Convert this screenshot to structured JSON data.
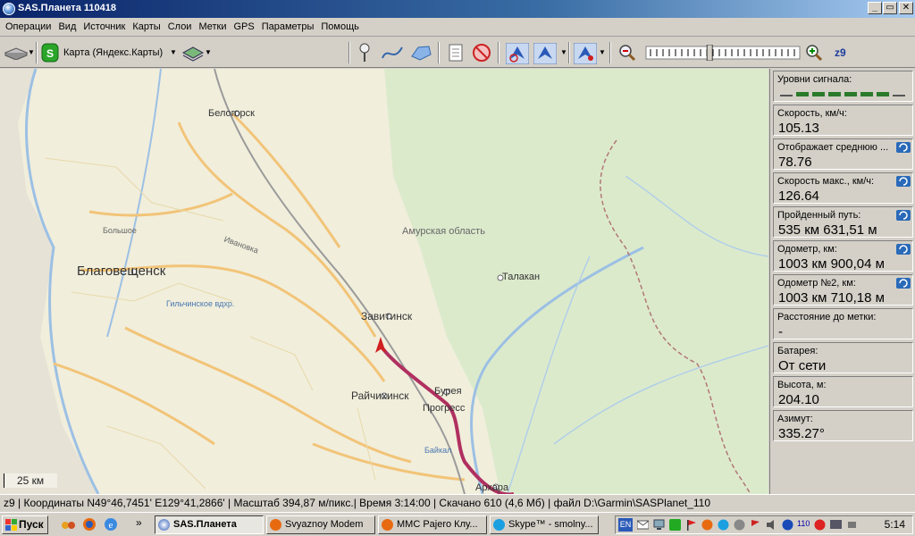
{
  "window": {
    "title": "SAS.Планета 110418",
    "minimize": "_",
    "maximize": "▭",
    "close": "✕"
  },
  "menu": [
    "Операции",
    "Вид",
    "Источник",
    "Карты",
    "Слои",
    "Метки",
    "GPS",
    "Параметры",
    "Помощь"
  ],
  "toolbar": {
    "map_source": "Карта (Яндекс.Карты)",
    "zoom_level": "z9",
    "zoom_slider_fraction": 0.41
  },
  "map": {
    "labels": {
      "blagoveshchensk": "Благовещенск",
      "belogorsk": "Белогорск",
      "zavitinsk": "Завитинск",
      "raichikhinsk": "Райчихинск",
      "progress": "Прогресс",
      "bureya": "Бурея",
      "talakan": "Талакан",
      "arkhara": "Архара",
      "amur_oblast": "Амурская область",
      "bolshoe": "Большое",
      "ivanovka": "Ивановка",
      "gilchin": "Гильчинское вдхр.",
      "baikal": "Байкал"
    },
    "scale": "25 км"
  },
  "sidebar": {
    "signal_label": "Уровни сигнала:",
    "signal_bars": 8,
    "panels": [
      {
        "label": "Скорость, км/ч:",
        "value": "105.13",
        "reset": false
      },
      {
        "label": "Отображает среднюю ...",
        "value": "78.76",
        "reset": true
      },
      {
        "label": "Скорость макс., км/ч:",
        "value": "126.64",
        "reset": true
      },
      {
        "label": "Пройденный путь:",
        "value": "535 км 631,51 м",
        "reset": true
      },
      {
        "label": "Одометр, км:",
        "value": "1003 км 900,04 м",
        "reset": true
      },
      {
        "label": "Одометр №2, км:",
        "value": "1003 км 710,18 м",
        "reset": true
      },
      {
        "label": "Расстояние до метки:",
        "value": "-",
        "reset": false
      },
      {
        "label": "Батарея:",
        "value": "От сети",
        "reset": false
      },
      {
        "label": "Высота, м:",
        "value": "204.10",
        "reset": false
      },
      {
        "label": "Азимут:",
        "value": "335.27°",
        "reset": false
      }
    ]
  },
  "status": "z9   | Координаты N49°46,7451' E129°41,2866' | Масштаб 394,87 м/пикс.| Время 3:14:00 | Скачано 610 (4,6 Мб) | файл D:\\Garmin\\SASPlanet_110",
  "taskbar": {
    "start": "Пуск",
    "more": "»",
    "tasks": [
      "SAS.Планета",
      "Svyaznoy Modem",
      "MMC Pajero Клу...",
      "Skype™ - smolny..."
    ],
    "tray_lang": "EN",
    "tray_num": "110",
    "clock": "5:14"
  },
  "colors": {
    "route": "#b03060",
    "road": "#f5c87a",
    "forest": "#d6e8c4",
    "water": "#a8c8e8"
  }
}
